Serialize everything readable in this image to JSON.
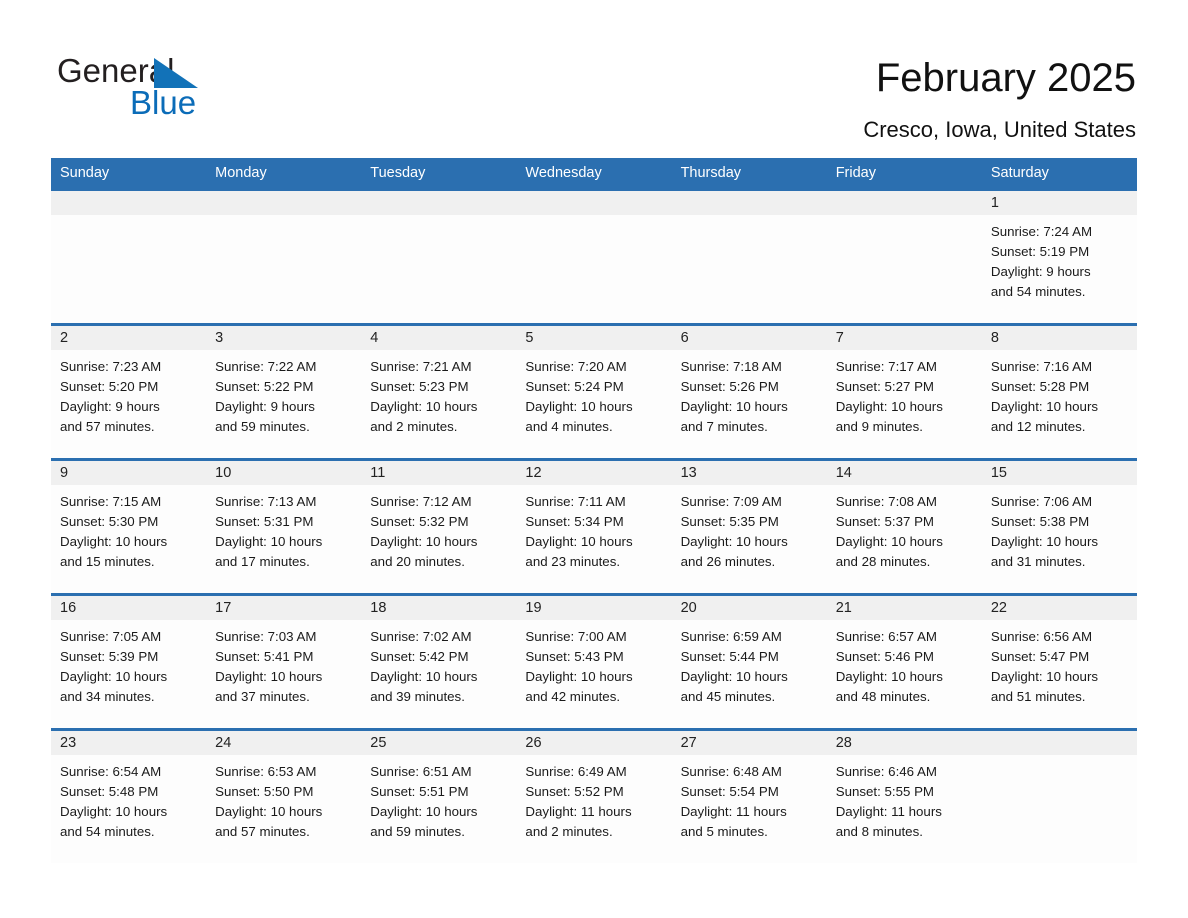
{
  "brand": {
    "name_part1": "General",
    "name_part2": "Blue",
    "accent_color": "#0b6cb8",
    "triangle_icon": "triangle-icon"
  },
  "header": {
    "title": "February 2025",
    "subtitle": "Cresco, Iowa, United States"
  },
  "colors": {
    "header_blue": "#2b6fb0",
    "daynum_band": "#f0f0f0",
    "cell_background": "#fdfdfd",
    "logo_blue": "#0b6cb8"
  },
  "weekdays": [
    "Sunday",
    "Monday",
    "Tuesday",
    "Wednesday",
    "Thursday",
    "Friday",
    "Saturday"
  ],
  "weeks": [
    {
      "days": [
        {
          "date": "",
          "empty": true,
          "sunrise": "",
          "sunset": "",
          "daylight_line1": "",
          "daylight_line2": ""
        },
        {
          "date": "",
          "empty": true,
          "sunrise": "",
          "sunset": "",
          "daylight_line1": "",
          "daylight_line2": ""
        },
        {
          "date": "",
          "empty": true,
          "sunrise": "",
          "sunset": "",
          "daylight_line1": "",
          "daylight_line2": ""
        },
        {
          "date": "",
          "empty": true,
          "sunrise": "",
          "sunset": "",
          "daylight_line1": "",
          "daylight_line2": ""
        },
        {
          "date": "",
          "empty": true,
          "sunrise": "",
          "sunset": "",
          "daylight_line1": "",
          "daylight_line2": ""
        },
        {
          "date": "",
          "empty": true,
          "sunrise": "",
          "sunset": "",
          "daylight_line1": "",
          "daylight_line2": ""
        },
        {
          "date": "1",
          "empty": false,
          "sunrise": "Sunrise: 7:24 AM",
          "sunset": "Sunset: 5:19 PM",
          "daylight_line1": "Daylight: 9 hours",
          "daylight_line2": "and 54 minutes."
        }
      ]
    },
    {
      "days": [
        {
          "date": "2",
          "empty": false,
          "sunrise": "Sunrise: 7:23 AM",
          "sunset": "Sunset: 5:20 PM",
          "daylight_line1": "Daylight: 9 hours",
          "daylight_line2": "and 57 minutes."
        },
        {
          "date": "3",
          "empty": false,
          "sunrise": "Sunrise: 7:22 AM",
          "sunset": "Sunset: 5:22 PM",
          "daylight_line1": "Daylight: 9 hours",
          "daylight_line2": "and 59 minutes."
        },
        {
          "date": "4",
          "empty": false,
          "sunrise": "Sunrise: 7:21 AM",
          "sunset": "Sunset: 5:23 PM",
          "daylight_line1": "Daylight: 10 hours",
          "daylight_line2": "and 2 minutes."
        },
        {
          "date": "5",
          "empty": false,
          "sunrise": "Sunrise: 7:20 AM",
          "sunset": "Sunset: 5:24 PM",
          "daylight_line1": "Daylight: 10 hours",
          "daylight_line2": "and 4 minutes."
        },
        {
          "date": "6",
          "empty": false,
          "sunrise": "Sunrise: 7:18 AM",
          "sunset": "Sunset: 5:26 PM",
          "daylight_line1": "Daylight: 10 hours",
          "daylight_line2": "and 7 minutes."
        },
        {
          "date": "7",
          "empty": false,
          "sunrise": "Sunrise: 7:17 AM",
          "sunset": "Sunset: 5:27 PM",
          "daylight_line1": "Daylight: 10 hours",
          "daylight_line2": "and 9 minutes."
        },
        {
          "date": "8",
          "empty": false,
          "sunrise": "Sunrise: 7:16 AM",
          "sunset": "Sunset: 5:28 PM",
          "daylight_line1": "Daylight: 10 hours",
          "daylight_line2": "and 12 minutes."
        }
      ]
    },
    {
      "days": [
        {
          "date": "9",
          "empty": false,
          "sunrise": "Sunrise: 7:15 AM",
          "sunset": "Sunset: 5:30 PM",
          "daylight_line1": "Daylight: 10 hours",
          "daylight_line2": "and 15 minutes."
        },
        {
          "date": "10",
          "empty": false,
          "sunrise": "Sunrise: 7:13 AM",
          "sunset": "Sunset: 5:31 PM",
          "daylight_line1": "Daylight: 10 hours",
          "daylight_line2": "and 17 minutes."
        },
        {
          "date": "11",
          "empty": false,
          "sunrise": "Sunrise: 7:12 AM",
          "sunset": "Sunset: 5:32 PM",
          "daylight_line1": "Daylight: 10 hours",
          "daylight_line2": "and 20 minutes."
        },
        {
          "date": "12",
          "empty": false,
          "sunrise": "Sunrise: 7:11 AM",
          "sunset": "Sunset: 5:34 PM",
          "daylight_line1": "Daylight: 10 hours",
          "daylight_line2": "and 23 minutes."
        },
        {
          "date": "13",
          "empty": false,
          "sunrise": "Sunrise: 7:09 AM",
          "sunset": "Sunset: 5:35 PM",
          "daylight_line1": "Daylight: 10 hours",
          "daylight_line2": "and 26 minutes."
        },
        {
          "date": "14",
          "empty": false,
          "sunrise": "Sunrise: 7:08 AM",
          "sunset": "Sunset: 5:37 PM",
          "daylight_line1": "Daylight: 10 hours",
          "daylight_line2": "and 28 minutes."
        },
        {
          "date": "15",
          "empty": false,
          "sunrise": "Sunrise: 7:06 AM",
          "sunset": "Sunset: 5:38 PM",
          "daylight_line1": "Daylight: 10 hours",
          "daylight_line2": "and 31 minutes."
        }
      ]
    },
    {
      "days": [
        {
          "date": "16",
          "empty": false,
          "sunrise": "Sunrise: 7:05 AM",
          "sunset": "Sunset: 5:39 PM",
          "daylight_line1": "Daylight: 10 hours",
          "daylight_line2": "and 34 minutes."
        },
        {
          "date": "17",
          "empty": false,
          "sunrise": "Sunrise: 7:03 AM",
          "sunset": "Sunset: 5:41 PM",
          "daylight_line1": "Daylight: 10 hours",
          "daylight_line2": "and 37 minutes."
        },
        {
          "date": "18",
          "empty": false,
          "sunrise": "Sunrise: 7:02 AM",
          "sunset": "Sunset: 5:42 PM",
          "daylight_line1": "Daylight: 10 hours",
          "daylight_line2": "and 39 minutes."
        },
        {
          "date": "19",
          "empty": false,
          "sunrise": "Sunrise: 7:00 AM",
          "sunset": "Sunset: 5:43 PM",
          "daylight_line1": "Daylight: 10 hours",
          "daylight_line2": "and 42 minutes."
        },
        {
          "date": "20",
          "empty": false,
          "sunrise": "Sunrise: 6:59 AM",
          "sunset": "Sunset: 5:44 PM",
          "daylight_line1": "Daylight: 10 hours",
          "daylight_line2": "and 45 minutes."
        },
        {
          "date": "21",
          "empty": false,
          "sunrise": "Sunrise: 6:57 AM",
          "sunset": "Sunset: 5:46 PM",
          "daylight_line1": "Daylight: 10 hours",
          "daylight_line2": "and 48 minutes."
        },
        {
          "date": "22",
          "empty": false,
          "sunrise": "Sunrise: 6:56 AM",
          "sunset": "Sunset: 5:47 PM",
          "daylight_line1": "Daylight: 10 hours",
          "daylight_line2": "and 51 minutes."
        }
      ]
    },
    {
      "days": [
        {
          "date": "23",
          "empty": false,
          "sunrise": "Sunrise: 6:54 AM",
          "sunset": "Sunset: 5:48 PM",
          "daylight_line1": "Daylight: 10 hours",
          "daylight_line2": "and 54 minutes."
        },
        {
          "date": "24",
          "empty": false,
          "sunrise": "Sunrise: 6:53 AM",
          "sunset": "Sunset: 5:50 PM",
          "daylight_line1": "Daylight: 10 hours",
          "daylight_line2": "and 57 minutes."
        },
        {
          "date": "25",
          "empty": false,
          "sunrise": "Sunrise: 6:51 AM",
          "sunset": "Sunset: 5:51 PM",
          "daylight_line1": "Daylight: 10 hours",
          "daylight_line2": "and 59 minutes."
        },
        {
          "date": "26",
          "empty": false,
          "sunrise": "Sunrise: 6:49 AM",
          "sunset": "Sunset: 5:52 PM",
          "daylight_line1": "Daylight: 11 hours",
          "daylight_line2": "and 2 minutes."
        },
        {
          "date": "27",
          "empty": false,
          "sunrise": "Sunrise: 6:48 AM",
          "sunset": "Sunset: 5:54 PM",
          "daylight_line1": "Daylight: 11 hours",
          "daylight_line2": "and 5 minutes."
        },
        {
          "date": "28",
          "empty": false,
          "sunrise": "Sunrise: 6:46 AM",
          "sunset": "Sunset: 5:55 PM",
          "daylight_line1": "Daylight: 11 hours",
          "daylight_line2": "and 8 minutes."
        },
        {
          "date": "",
          "empty": true,
          "sunrise": "",
          "sunset": "",
          "daylight_line1": "",
          "daylight_line2": ""
        }
      ]
    }
  ]
}
